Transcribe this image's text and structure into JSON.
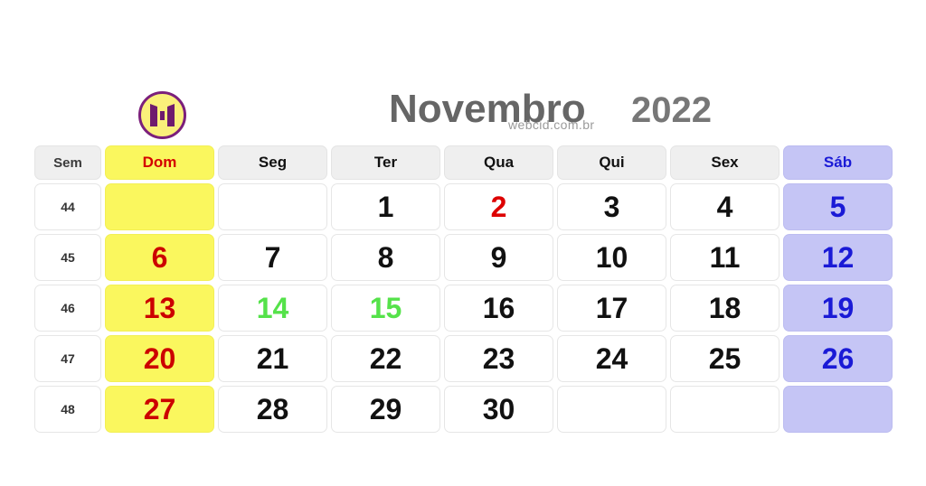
{
  "header": {
    "logo_icon": "webcid-logo-icon",
    "month": "Novembro",
    "year": "2022",
    "watermark": "webcid.com.br"
  },
  "colors": {
    "sunday_bg": "#FAF75E",
    "saturday_bg": "#C5C5F5",
    "weekday_header_bg": "#EFEFEF",
    "sunday_text": "#CC0000",
    "saturday_text": "#1A1AD6",
    "holiday_text": "#DD0000",
    "special_text": "#55E24A",
    "default_text": "#111111",
    "title_text": "#666666",
    "watermark_text": "#9A9A9A",
    "logo_fill": "#FAF07A",
    "logo_stroke": "#7B1F7B"
  },
  "calendar": {
    "column_headers": [
      {
        "label": "Sem",
        "kind": "week"
      },
      {
        "label": "Dom",
        "kind": "sunday"
      },
      {
        "label": "Seg",
        "kind": "weekday"
      },
      {
        "label": "Ter",
        "kind": "weekday"
      },
      {
        "label": "Qua",
        "kind": "weekday"
      },
      {
        "label": "Qui",
        "kind": "weekday"
      },
      {
        "label": "Sex",
        "kind": "weekday"
      },
      {
        "label": "Sáb",
        "kind": "saturday"
      }
    ],
    "rows": [
      {
        "week": "44",
        "days": [
          {
            "label": "",
            "kind": "sunday"
          },
          {
            "label": "",
            "kind": "weekday"
          },
          {
            "label": "1",
            "kind": "weekday"
          },
          {
            "label": "2",
            "kind": "holiday"
          },
          {
            "label": "3",
            "kind": "weekday"
          },
          {
            "label": "4",
            "kind": "weekday"
          },
          {
            "label": "5",
            "kind": "saturday"
          }
        ]
      },
      {
        "week": "45",
        "days": [
          {
            "label": "6",
            "kind": "sunday"
          },
          {
            "label": "7",
            "kind": "weekday"
          },
          {
            "label": "8",
            "kind": "weekday"
          },
          {
            "label": "9",
            "kind": "weekday"
          },
          {
            "label": "10",
            "kind": "weekday"
          },
          {
            "label": "11",
            "kind": "weekday"
          },
          {
            "label": "12",
            "kind": "saturday"
          }
        ]
      },
      {
        "week": "46",
        "days": [
          {
            "label": "13",
            "kind": "sunday"
          },
          {
            "label": "14",
            "kind": "special"
          },
          {
            "label": "15",
            "kind": "special"
          },
          {
            "label": "16",
            "kind": "weekday"
          },
          {
            "label": "17",
            "kind": "weekday"
          },
          {
            "label": "18",
            "kind": "weekday"
          },
          {
            "label": "19",
            "kind": "saturday"
          }
        ]
      },
      {
        "week": "47",
        "days": [
          {
            "label": "20",
            "kind": "sunday"
          },
          {
            "label": "21",
            "kind": "weekday"
          },
          {
            "label": "22",
            "kind": "weekday"
          },
          {
            "label": "23",
            "kind": "weekday"
          },
          {
            "label": "24",
            "kind": "weekday"
          },
          {
            "label": "25",
            "kind": "weekday"
          },
          {
            "label": "26",
            "kind": "saturday"
          }
        ]
      },
      {
        "week": "48",
        "days": [
          {
            "label": "27",
            "kind": "sunday"
          },
          {
            "label": "28",
            "kind": "weekday"
          },
          {
            "label": "29",
            "kind": "weekday"
          },
          {
            "label": "30",
            "kind": "weekday"
          },
          {
            "label": "",
            "kind": "weekday"
          },
          {
            "label": "",
            "kind": "weekday"
          },
          {
            "label": "",
            "kind": "saturday"
          }
        ]
      }
    ]
  }
}
